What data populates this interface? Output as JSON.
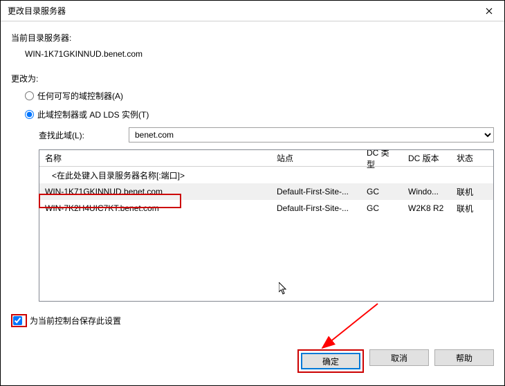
{
  "titlebar": {
    "title": "更改目录服务器"
  },
  "labels": {
    "current_server": "当前目录服务器:",
    "current_server_value": "WIN-1K71GKINNUD.benet.com",
    "change_to": "更改为:",
    "radio_any": "任何可写的域控制器(A)",
    "radio_this": "此域控制器或 AD LDS 实例(T)",
    "search_domain": "查找此域(L):",
    "domain_value": "benet.com",
    "checkbox": "为当前控制台保存此设置"
  },
  "table": {
    "headers": {
      "name": "名称",
      "site": "站点",
      "dctype": "DC 类型",
      "dcver": "DC 版本",
      "status": "状态"
    },
    "placeholder": "<在此处键入目录服务器名称[:端口]>",
    "rows": [
      {
        "name": "WIN-1K71GKINNUD.benet.com",
        "site": "Default-First-Site-...",
        "dctype": "GC",
        "dcver": "Windo...",
        "status": "联机",
        "selected": true
      },
      {
        "name": "WIN-7K2H4UIC7KT.benet.com",
        "site": "Default-First-Site-...",
        "dctype": "GC",
        "dcver": "W2K8 R2",
        "status": "联机",
        "selected": false
      }
    ]
  },
  "buttons": {
    "ok": "确定",
    "cancel": "取消",
    "help": "帮助"
  }
}
